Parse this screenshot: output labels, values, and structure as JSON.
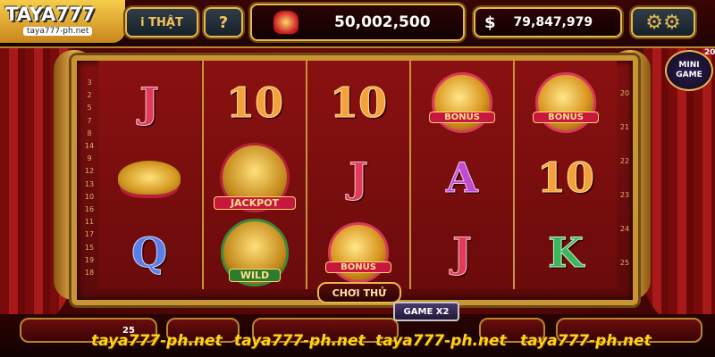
{
  "topbar": {
    "logo_brand": "TAYA777",
    "logo_site": "taya777-ph.net",
    "room_button": "i THẬT",
    "help_button": "?",
    "jackpot_value": "50,002,500",
    "balance_currency": "$",
    "balance_value": "79,847,979"
  },
  "mini_game": {
    "label_line1": "MINI",
    "label_line2": "GAME",
    "badge": "20"
  },
  "paylines_left": [
    "3",
    "2",
    "5",
    "7",
    "8",
    "14",
    "9",
    "12",
    "13",
    "10",
    "16",
    "11",
    "17",
    "15",
    "19",
    "18"
  ],
  "paylines_right": [
    "20",
    "21",
    "22",
    "23",
    "24",
    "25"
  ],
  "reels": [
    {
      "symbols": [
        {
          "type": "letter",
          "value": "J",
          "color": "red"
        },
        {
          "type": "image",
          "name": "gold-ingot"
        },
        {
          "type": "letter",
          "value": "Q",
          "color": "blue"
        }
      ]
    },
    {
      "symbols": [
        {
          "type": "letter",
          "value": "10",
          "color": "gold"
        },
        {
          "type": "jackpot",
          "label": "JACKPOT"
        },
        {
          "type": "wild",
          "label": "WILD"
        }
      ]
    },
    {
      "symbols": [
        {
          "type": "letter",
          "value": "10",
          "color": "gold"
        },
        {
          "type": "letter",
          "value": "J",
          "color": "red"
        },
        {
          "type": "bonus",
          "label": "BONUS"
        }
      ]
    },
    {
      "symbols": [
        {
          "type": "bonus",
          "label": "BONUS"
        },
        {
          "type": "letter",
          "value": "A",
          "color": "purple"
        },
        {
          "type": "letter",
          "value": "J",
          "color": "red"
        }
      ]
    },
    {
      "symbols": [
        {
          "type": "bonus",
          "label": "BONUS"
        },
        {
          "type": "letter",
          "value": "10",
          "color": "gold"
        },
        {
          "type": "letter",
          "value": "K",
          "color": "green"
        }
      ]
    }
  ],
  "controls": {
    "choi_thu": "CHƠI THỬ",
    "game_x2": "GAME X2",
    "lines_value": "25"
  },
  "watermarks": [
    "taya777-ph.net",
    "taya777-ph.net",
    "taya777-ph.net",
    "taya777-ph.net"
  ],
  "colors": {
    "gold_border": "#e7b650",
    "red_bg": "#7e1010",
    "watermark": "#ffd21a"
  }
}
